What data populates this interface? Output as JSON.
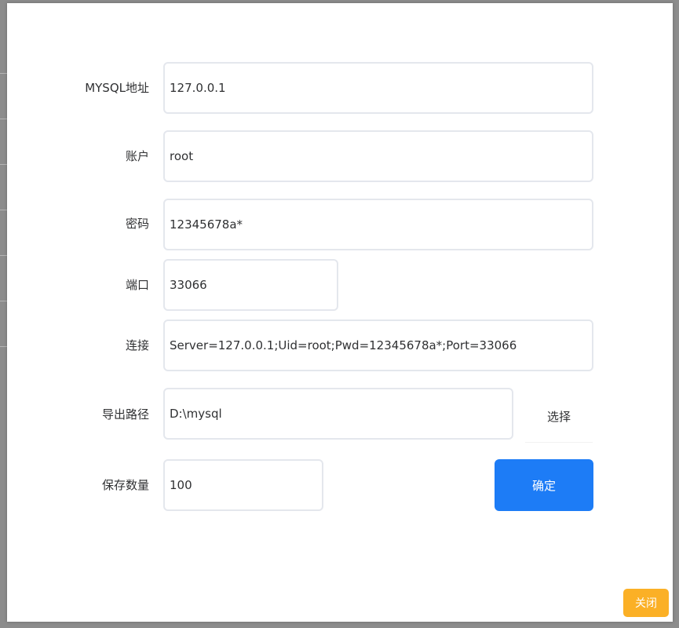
{
  "form": {
    "mysql_address": {
      "label": "MYSQL地址",
      "value": "127.0.0.1"
    },
    "account": {
      "label": "账户",
      "value": "root"
    },
    "password": {
      "label": "密码",
      "value": "12345678a*"
    },
    "port": {
      "label": "端口",
      "value": "33066"
    },
    "connection": {
      "label": "连接",
      "value": "Server=127.0.0.1;Uid=root;Pwd=12345678a*;Port=33066"
    },
    "export_path": {
      "label": "导出路径",
      "value": "D:\\mysql",
      "select_label": "选择"
    },
    "save_count": {
      "label": "保存数量",
      "value": "100"
    }
  },
  "actions": {
    "confirm_label": "确定",
    "close_label": "关闭"
  },
  "colors": {
    "primary": "#1d7cf6",
    "warning": "#fbb026",
    "border": "#e4e7ed",
    "overlay": "#8c8c8c"
  }
}
